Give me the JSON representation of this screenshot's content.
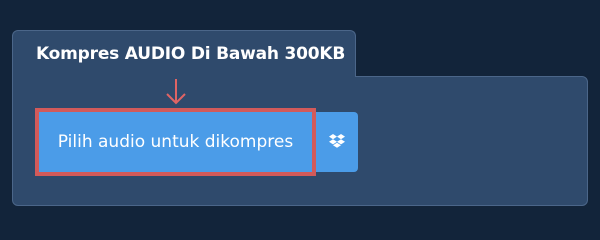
{
  "panel": {
    "title": "Kompres AUDIO Di Bawah 300KB"
  },
  "upload": {
    "button_label": "Pilih audio untuk dikompres",
    "arrow_icon": "arrow-down-icon",
    "dropbox_icon": "dropbox-icon"
  },
  "colors": {
    "background": "#12243a",
    "panel": "#2f4a6c",
    "button": "#4b9ce8",
    "highlight": "#d25a5a"
  }
}
